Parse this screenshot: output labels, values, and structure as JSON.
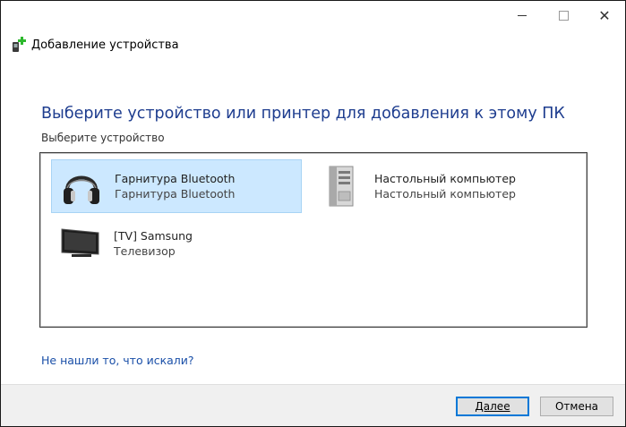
{
  "window": {
    "title": "Добавление устройства"
  },
  "caption": {
    "minimize": "",
    "maximize": "",
    "close": "✕"
  },
  "main": {
    "heading": "Выберите устройство или принтер для добавления к этому ПК",
    "sublabel": "Выберите устройство",
    "devices": [
      {
        "name": "Гарнитура Bluetooth",
        "type": "Гарнитура Bluetooth",
        "icon": "headphones-icon",
        "selected": true
      },
      {
        "name": "Настольный компьютер",
        "type": "Настольный компьютер",
        "icon": "desktop-tower-icon",
        "selected": false
      },
      {
        "name": "[TV] Samsung",
        "type": "Телевизор",
        "icon": "tv-icon",
        "selected": false
      }
    ],
    "not_found_link": "Не нашли то, что искали?"
  },
  "footer": {
    "next_label": "Далее",
    "cancel_label": "Отмена"
  },
  "colors": {
    "heading": "#1e3d8f",
    "link": "#1a4fa8",
    "selection": "#cce8ff",
    "primary_border": "#0078d7"
  }
}
